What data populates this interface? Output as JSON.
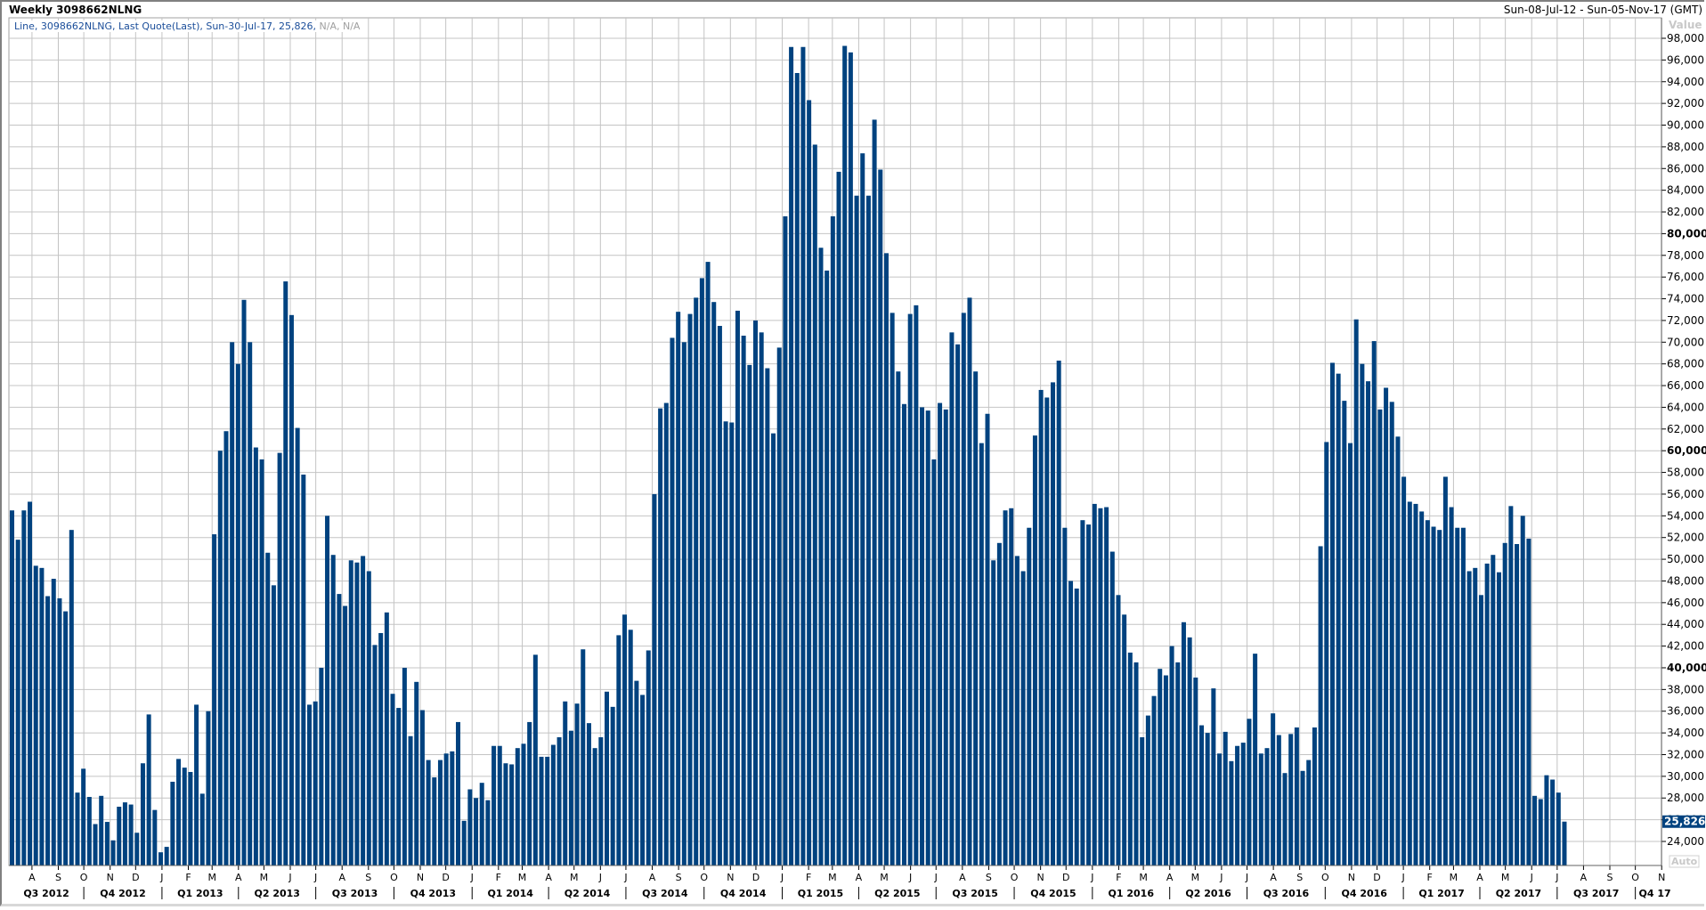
{
  "header": {
    "title": "Weekly 3098662NLNG",
    "date_range": "Sun-08-Jul-12 - Sun-05-Nov-17 (GMT)"
  },
  "legend": {
    "text": "Line, 3098662NLNG, Last Quote(Last), Sun-30-Jul-17, 25,826,",
    "na_text": "N/A, N/A"
  },
  "colors": {
    "bar": "#00427f",
    "grid": "#c4c4c4",
    "last_badge": "#00427f"
  },
  "chart_data": {
    "type": "bar",
    "title": "Weekly 3098662NLNG",
    "ylabel": "Value",
    "ylim": [
      22000,
      99500
    ],
    "yticks_step": 2000,
    "ytick_min": 24000,
    "ytick_max": 98000,
    "bold_ticks": [
      40000,
      60000,
      80000
    ],
    "grid": true,
    "x_start": "2012-07-08",
    "x_end": "2017-11-05",
    "interval": "weekly",
    "last_value_label": "25,826",
    "auto_label": "Auto",
    "month_labels": [
      "A",
      "S",
      "O",
      "N",
      "D",
      "J",
      "F",
      "M",
      "A",
      "M",
      "J",
      "J",
      "A",
      "S",
      "O",
      "N",
      "D",
      "J",
      "F",
      "M",
      "A",
      "M",
      "J",
      "J",
      "A",
      "S",
      "O",
      "N",
      "D",
      "J",
      "F",
      "M",
      "A",
      "M",
      "J",
      "J",
      "A",
      "S",
      "O",
      "N",
      "D",
      "J",
      "F",
      "M",
      "A",
      "M",
      "J",
      "J",
      "A",
      "S",
      "O",
      "N",
      "D",
      "J",
      "F",
      "M",
      "A",
      "M",
      "J",
      "J",
      "A",
      "S",
      "O",
      "N"
    ],
    "quarter_labels": [
      "Q3 2012",
      "Q4 2012",
      "Q1 2013",
      "Q2 2013",
      "Q3 2013",
      "Q4 2013",
      "Q1 2014",
      "Q2 2014",
      "Q3 2014",
      "Q4 2014",
      "Q1 2015",
      "Q2 2015",
      "Q3 2015",
      "Q4 2015",
      "Q1 2016",
      "Q2 2016",
      "Q3 2016",
      "Q4 2016",
      "Q1 2017",
      "Q2 2017",
      "Q3 2017",
      "Q4 17"
    ],
    "values": [
      54500,
      51800,
      54500,
      55300,
      49400,
      49200,
      46600,
      48200,
      46400,
      45200,
      52700,
      28500,
      30700,
      28100,
      25600,
      28200,
      25800,
      24100,
      27200,
      27600,
      27400,
      24800,
      31200,
      35700,
      26900,
      23000,
      23500,
      29500,
      31600,
      30800,
      30400,
      36600,
      28400,
      36000,
      52300,
      60000,
      61800,
      70000,
      68000,
      73900,
      70000,
      60300,
      59200,
      50600,
      47600,
      59800,
      75600,
      72500,
      62100,
      57800,
      36600,
      36900,
      40000,
      54000,
      50400,
      46800,
      45700,
      49900,
      49700,
      50300,
      48900,
      42100,
      43200,
      45100,
      37600,
      36300,
      40000,
      33700,
      38700,
      36100,
      31500,
      29900,
      31500,
      32100,
      32300,
      35000,
      25900,
      28800,
      28000,
      29400,
      27800,
      32800,
      32800,
      31200,
      31100,
      32600,
      33000,
      35000,
      41200,
      31800,
      31800,
      32900,
      33600,
      36900,
      34200,
      36700,
      41700,
      34900,
      32600,
      33600,
      37800,
      36400,
      43000,
      44900,
      43500,
      38800,
      37500,
      41600,
      56000,
      63900,
      64400,
      70400,
      72800,
      70000,
      72600,
      74100,
      75900,
      77400,
      73700,
      71500,
      62700,
      62600,
      72900,
      70600,
      67900,
      72000,
      70900,
      67600,
      61600,
      69500,
      81600,
      97200,
      94800,
      97200,
      92300,
      88200,
      78700,
      76600,
      81600,
      85700,
      97300,
      96700,
      83500,
      87400,
      83500,
      90500,
      85900,
      78200,
      72700,
      67300,
      64300,
      72600,
      73400,
      64000,
      63700,
      59200,
      64400,
      63800,
      70900,
      69800,
      72700,
      74100,
      67300,
      60700,
      63400,
      49900,
      51500,
      54500,
      54700,
      50300,
      48900,
      52900,
      61400,
      65600,
      64900,
      66300,
      68300,
      52900,
      48000,
      47300,
      53600,
      53200,
      55100,
      54700,
      54800,
      50700,
      46700,
      44900,
      41400,
      40500,
      33600,
      35600,
      37400,
      39900,
      39300,
      42000,
      40500,
      44200,
      42800,
      39100,
      34700,
      34000,
      38100,
      32100,
      34100,
      31400,
      32800,
      33100,
      35300,
      41300,
      32100,
      32600,
      35800,
      33800,
      30300,
      33900,
      34500,
      30500,
      31500,
      34500,
      51200,
      60800,
      68100,
      67100,
      64600,
      60700,
      72100,
      68000,
      66400,
      70100,
      63800,
      65800,
      64500,
      61300,
      57600,
      55300,
      55100,
      54400,
      53600,
      53000,
      52700,
      57600,
      54800,
      52900,
      52900,
      48900,
      49200,
      46700,
      49600,
      50400,
      48800,
      51500,
      54900,
      51400,
      54000,
      51900,
      28200,
      27900,
      30100,
      29700,
      28500,
      25826
    ]
  }
}
